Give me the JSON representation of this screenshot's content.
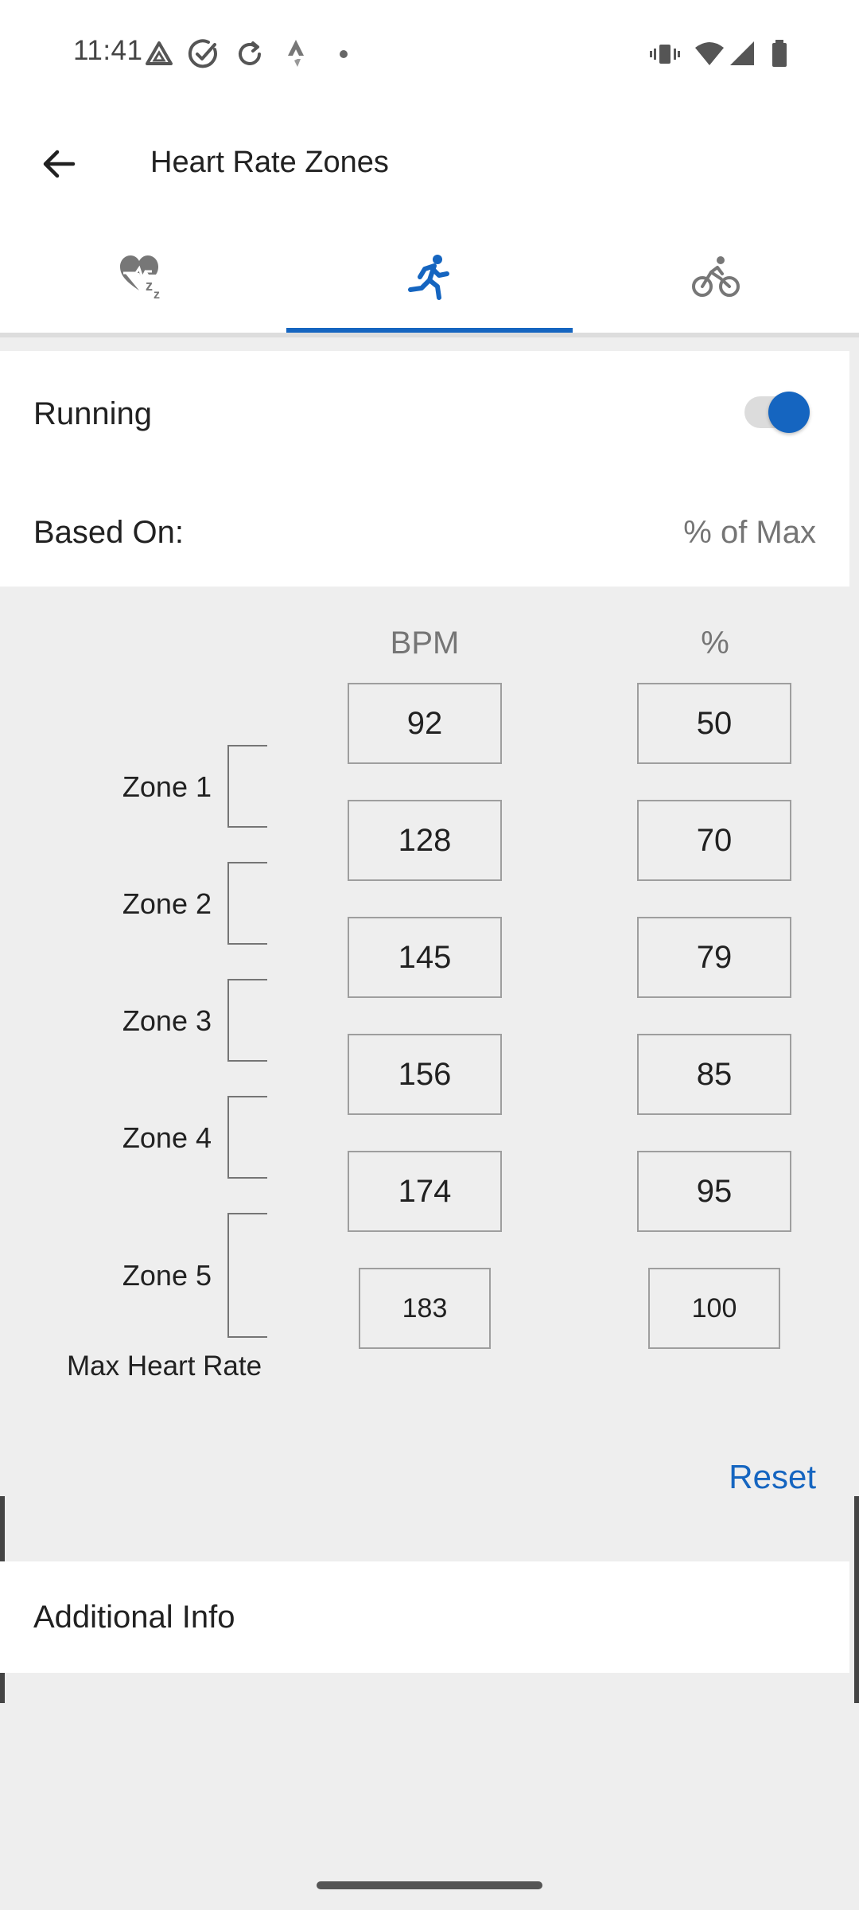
{
  "status_bar": {
    "time": "11:41",
    "left_icons": [
      "drive-icon",
      "check-circle-icon",
      "sync-icon",
      "strava-icon",
      "dot-icon"
    ],
    "right_icons": [
      "vibrate-icon",
      "wifi-icon",
      "signal-icon",
      "battery-icon"
    ]
  },
  "app_bar": {
    "title": "Heart Rate Zones",
    "back_icon": "arrow-back-icon"
  },
  "tabs": [
    {
      "icon": "heart-sleep-icon",
      "selected": false
    },
    {
      "icon": "running-icon",
      "selected": true
    },
    {
      "icon": "cycling-icon",
      "selected": false
    }
  ],
  "colors": {
    "accent": "#1565c0",
    "background": "#eeeeee",
    "card": "#ffffff"
  },
  "activity": {
    "label": "Running",
    "enabled": true
  },
  "based_on": {
    "label": "Based On:",
    "value": "% of Max"
  },
  "grid": {
    "bpm_header": "BPM",
    "pct_header": "%",
    "bpm": [
      "92",
      "128",
      "145",
      "156",
      "174",
      "183"
    ],
    "pct": [
      "50",
      "70",
      "79",
      "85",
      "95",
      "100"
    ],
    "zones": [
      "Zone 1",
      "Zone 2",
      "Zone 3",
      "Zone 4",
      "Zone 5"
    ],
    "max_label": "Max Heart Rate"
  },
  "reset_label": "Reset",
  "additional_info_label": "Additional Info"
}
